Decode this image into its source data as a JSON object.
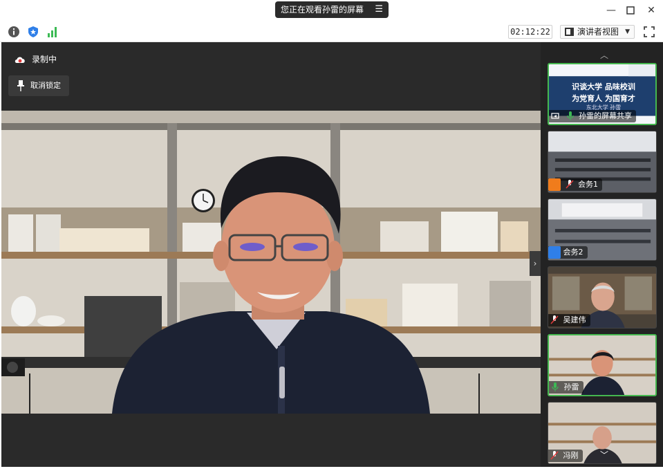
{
  "titlebar": {
    "share_status": "您正在观看孙雷的屏幕",
    "menu_icon": "list-menu-icon",
    "minimize_icon": "minimize-icon",
    "maximize_icon": "maximize-icon",
    "close_icon": "close-icon"
  },
  "toolbar": {
    "info_icon": "info-icon",
    "security_icon": "shield-icon",
    "network_icon": "signal-bars-icon",
    "timer": "02:12:22",
    "view_mode": "演讲者视图",
    "fullscreen_icon": "fullscreen-icon",
    "colors": {
      "security": "#2f7fe8",
      "network": "#3cba54"
    }
  },
  "stage": {
    "recording_label": "录制中",
    "recording_icon": "cloud-record-icon",
    "unpin_label": "取消锁定",
    "pin_icon": "pin-icon",
    "next_icon": "chevron-right-icon"
  },
  "sidebar": {
    "up_icon": "chevron-up-icon",
    "down_icon": "chevron-down-icon",
    "tiles": [
      {
        "name": "孙雷的屏幕共享",
        "slide_line1": "识谈大学  品味校训",
        "slide_line2": "为党育人  为国育才",
        "slide_line3": "东北大学 孙雷",
        "icon": "screen-share-icon",
        "mic": "mic-on-icon",
        "active": true
      },
      {
        "name": "会务1",
        "icon": "avatar-icon",
        "mic": "mic-muted-icon",
        "active": false
      },
      {
        "name": "会务2",
        "icon": "avatar-icon",
        "mic": "",
        "active": false
      },
      {
        "name": "吴建伟",
        "icon": "",
        "mic": "mic-muted-icon",
        "active": false
      },
      {
        "name": "孙雷",
        "icon": "",
        "mic": "mic-on-icon",
        "active": true
      },
      {
        "name": "冯刚",
        "icon": "",
        "mic": "mic-muted-icon",
        "active": false
      }
    ],
    "colors": {
      "active_border": "#45b84f",
      "avatar_orange": "#f07c1c",
      "avatar_blue": "#2f7fe8",
      "mic_on": "#3cba54"
    }
  }
}
